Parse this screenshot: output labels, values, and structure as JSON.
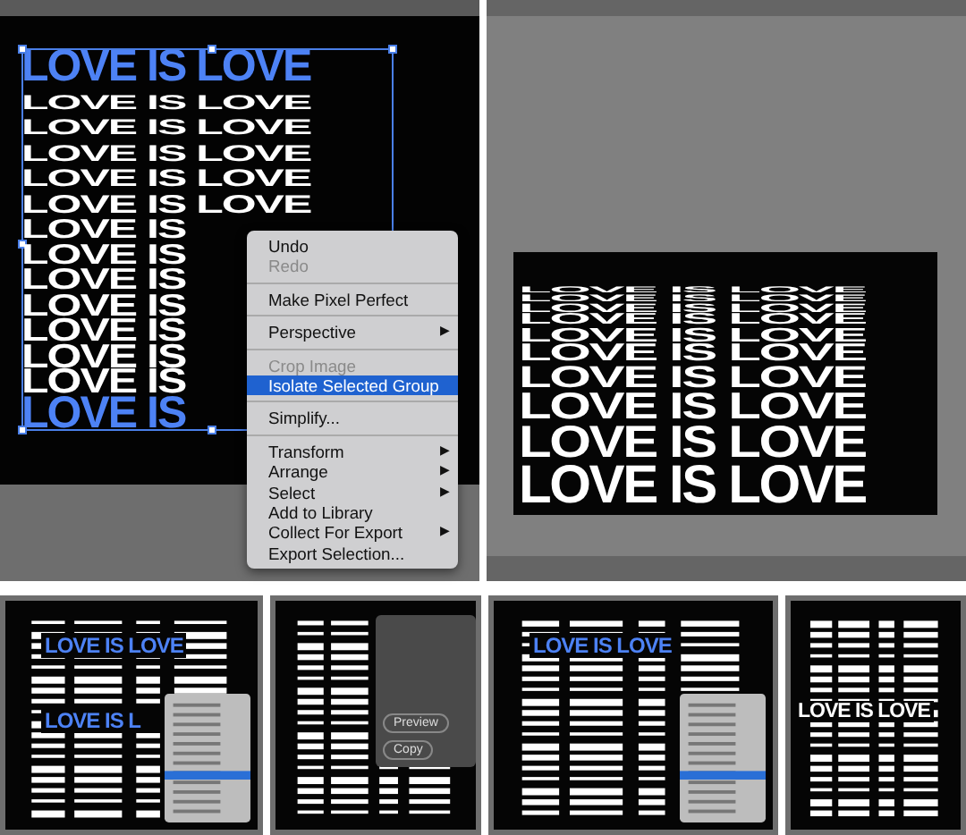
{
  "editor_panel": {
    "artwork": {
      "top_line": "LOVE IS LOVE",
      "rows": [
        "LOVE IS LOVE",
        "LOVE IS LOVE",
        "LOVE IS LOVE",
        "LOVE IS LOVE",
        "LOVE IS LOVE",
        "LOVE IS",
        "LOVE IS",
        "LOVE IS",
        "LOVE IS",
        "LOVE IS",
        "LOVE IS",
        "LOVE IS"
      ],
      "bottom_line": "LOVE IS"
    },
    "context_menu": [
      {
        "kind": "item",
        "label": "Undo",
        "disabled": false,
        "selected": false
      },
      {
        "kind": "item",
        "label": "Redo",
        "disabled": true,
        "selected": false
      },
      {
        "kind": "separator"
      },
      {
        "kind": "item",
        "label": "Make Pixel Perfect",
        "disabled": false,
        "selected": false
      },
      {
        "kind": "separator"
      },
      {
        "kind": "item",
        "label": "Perspective",
        "arrow": "▶",
        "disabled": false,
        "selected": false
      },
      {
        "kind": "separator"
      },
      {
        "kind": "item",
        "label": "Crop Image",
        "disabled": true,
        "selected": false
      },
      {
        "kind": "item",
        "label": "Isolate Selected Group",
        "disabled": false,
        "selected": true
      },
      {
        "kind": "separator"
      },
      {
        "kind": "item",
        "label": "Simplify...",
        "disabled": false,
        "selected": false
      },
      {
        "kind": "separator"
      },
      {
        "kind": "item",
        "label": "Transform",
        "arrow": "▶",
        "disabled": false,
        "selected": false
      },
      {
        "kind": "item",
        "label": "Arrange",
        "arrow": "▶",
        "disabled": false,
        "selected": false
      },
      {
        "kind": "item",
        "label": "Select",
        "arrow": "▶",
        "disabled": false,
        "selected": false
      },
      {
        "kind": "item",
        "label": "Add to Library",
        "disabled": false,
        "selected": false
      },
      {
        "kind": "item",
        "label": "Collect For Export",
        "arrow": "▶",
        "disabled": false,
        "selected": false
      },
      {
        "kind": "item",
        "label": "Export Selection...",
        "disabled": false,
        "selected": false
      }
    ]
  },
  "result_panel": {
    "rows": [
      "LOVE IS LOVE",
      "LOVE IS LOVE",
      "LOVE IS LOVE",
      "LOVE IS LOVE",
      "LOVE IS LOVE",
      "LOVE IS LOVE",
      "LOVE IS LOVE",
      "LOVE IS LOVE",
      "LOVE IS LOVE",
      "LOVE IS LOVE"
    ]
  },
  "thumbnails": [
    {
      "kind": "menu",
      "labels": [
        "LOVE IS LOVE",
        "LOVE IS L"
      ]
    },
    {
      "kind": "dialog",
      "buttons": [
        "Preview",
        "Copy"
      ]
    },
    {
      "kind": "menu",
      "labels": [
        "LOVE IS LOVE"
      ]
    },
    {
      "kind": "result",
      "labels": [
        "LOVE IS LOVE"
      ]
    }
  ]
}
